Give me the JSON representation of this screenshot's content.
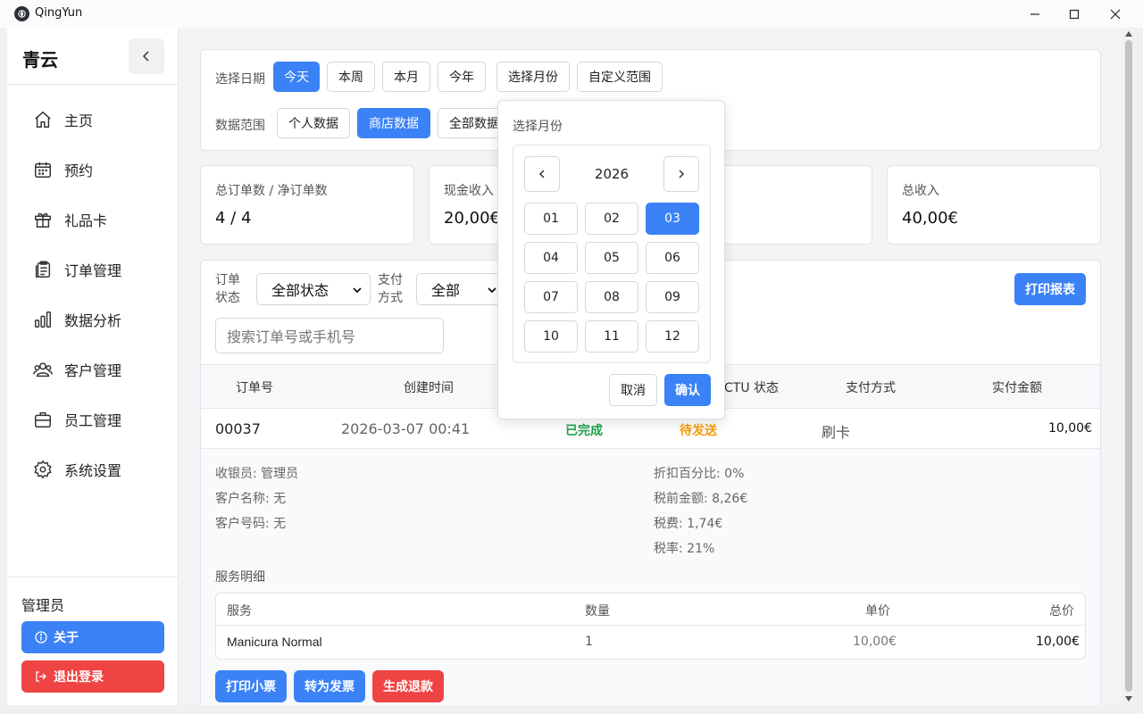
{
  "window": {
    "title": "QingYun"
  },
  "sidebar": {
    "brand": "青云",
    "items": [
      {
        "label": "主页",
        "icon": "home-icon"
      },
      {
        "label": "预约",
        "icon": "calendar-icon"
      },
      {
        "label": "礼品卡",
        "icon": "gift-icon"
      },
      {
        "label": "订单管理",
        "icon": "clipboard-icon"
      },
      {
        "label": "数据分析",
        "icon": "bar-chart-icon"
      },
      {
        "label": "客户管理",
        "icon": "users-icon"
      },
      {
        "label": "员工管理",
        "icon": "briefcase-icon"
      },
      {
        "label": "系统设置",
        "icon": "gear-icon"
      }
    ],
    "user": "管理员",
    "about": "关于",
    "logout": "退出登录"
  },
  "filters": {
    "date_label": "选择日期",
    "date_options": [
      "今天",
      "本周",
      "本月",
      "今年",
      "选择月份",
      "自定义范围"
    ],
    "date_selected": "今天",
    "scope_label": "数据范围",
    "scope_options": [
      "个人数据",
      "商店数据",
      "全部数据"
    ],
    "scope_selected": "商店数据"
  },
  "stats": [
    {
      "label": "总订单数 / 净订单数",
      "value": "4 / 4"
    },
    {
      "label": "现金收入",
      "value": "20,00€"
    },
    {
      "label": "",
      "value": ""
    },
    {
      "label": "总收入",
      "value": "40,00€"
    }
  ],
  "orders": {
    "status_label_1": "订单",
    "status_label_2": "状态",
    "status_value": "全部状态",
    "pay_label_1": "支付",
    "pay_label_2": "方式",
    "pay_value": "全部",
    "search_placeholder": "搜索订单号或手机号",
    "print_report": "打印报表",
    "columns": [
      "订单号",
      "创建时间",
      "CTU 状态",
      "支付方式",
      "实付金额"
    ],
    "row": {
      "id": "00037",
      "time": "2026-03-07 00:41",
      "status": "已完成",
      "ctu_status": "待发送",
      "payment": "刷卡",
      "amount": "10,00€"
    },
    "details_left": [
      "收银员: 管理员",
      "客户名称: 无",
      "客户号码: 无"
    ],
    "details_right": [
      "折扣百分比: 0%",
      "税前金额: 8,26€",
      "税费: 1,74€",
      "税率: 21%"
    ],
    "services_title": "服务明细",
    "service_columns": [
      "服务",
      "数量",
      "单价",
      "总价"
    ],
    "service_row": {
      "name": "Manicura Normal",
      "qty": "1",
      "unit": "10,00€",
      "total": "10,00€"
    },
    "actions": [
      "打印小票",
      "转为发票",
      "生成退款"
    ]
  },
  "month_picker": {
    "title": "选择月份",
    "year": "2026",
    "months": [
      "01",
      "02",
      "03",
      "04",
      "05",
      "06",
      "07",
      "08",
      "09",
      "10",
      "11",
      "12"
    ],
    "selected": "03",
    "cancel": "取消",
    "confirm": "确认"
  },
  "colors": {
    "accent": "#3b82f6",
    "danger": "#ef4444",
    "success": "#22a34a",
    "warning": "#f59e0b"
  }
}
